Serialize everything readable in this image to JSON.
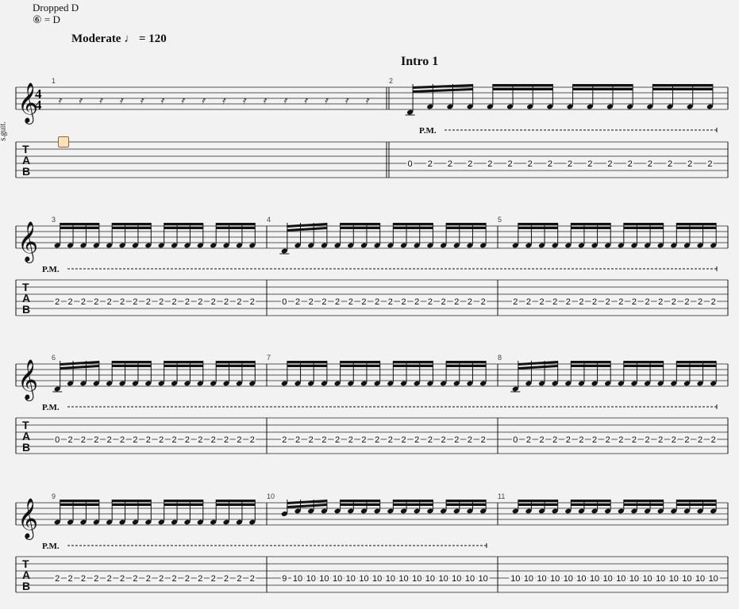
{
  "tuning": {
    "name": "Dropped D",
    "string": "⑥ = D"
  },
  "tempo": {
    "label": "Moderate",
    "note": "♩",
    "value": "= 120"
  },
  "section": "Intro 1",
  "instrument": "s.guit.",
  "time_signature": {
    "top": "4",
    "bottom": "4"
  },
  "tab_letters": [
    "T",
    "A",
    "B"
  ],
  "pm_label": "P.M.",
  "colors": {
    "line": "#555555",
    "ink": "#111111",
    "cursor": "#fbe3b4"
  },
  "systems": [
    {
      "measures": [
        {
          "number": "1",
          "rest": true,
          "frets": []
        },
        {
          "number": "2",
          "rest": false,
          "frets": [
            "0",
            "2",
            "2",
            "2",
            "2",
            "2",
            "2",
            "2",
            "2",
            "2",
            "2",
            "2",
            "2",
            "2",
            "2",
            "2"
          ],
          "pm": true
        }
      ]
    },
    {
      "measures": [
        {
          "number": "3",
          "rest": false,
          "frets": [
            "2",
            "2",
            "2",
            "2",
            "2",
            "2",
            "2",
            "2",
            "2",
            "2",
            "2",
            "2",
            "2",
            "2",
            "2",
            "2"
          ],
          "pm": true
        },
        {
          "number": "4",
          "rest": false,
          "frets": [
            "0",
            "2",
            "2",
            "2",
            "2",
            "2",
            "2",
            "2",
            "2",
            "2",
            "2",
            "2",
            "2",
            "2",
            "2",
            "2"
          ],
          "pm": true
        },
        {
          "number": "5",
          "rest": false,
          "frets": [
            "2",
            "2",
            "2",
            "2",
            "2",
            "2",
            "2",
            "2",
            "2",
            "2",
            "2",
            "2",
            "2",
            "2",
            "2",
            "2"
          ],
          "pm": true
        }
      ]
    },
    {
      "measures": [
        {
          "number": "6",
          "rest": false,
          "frets": [
            "0",
            "2",
            "2",
            "2",
            "2",
            "2",
            "2",
            "2",
            "2",
            "2",
            "2",
            "2",
            "2",
            "2",
            "2",
            "2"
          ],
          "pm": true
        },
        {
          "number": "7",
          "rest": false,
          "frets": [
            "2",
            "2",
            "2",
            "2",
            "2",
            "2",
            "2",
            "2",
            "2",
            "2",
            "2",
            "2",
            "2",
            "2",
            "2",
            "2"
          ],
          "pm": true
        },
        {
          "number": "8",
          "rest": false,
          "frets": [
            "0",
            "2",
            "2",
            "2",
            "2",
            "2",
            "2",
            "2",
            "2",
            "2",
            "2",
            "2",
            "2",
            "2",
            "2",
            "2"
          ],
          "pm": true
        }
      ]
    },
    {
      "measures": [
        {
          "number": "9",
          "rest": false,
          "frets": [
            "2",
            "2",
            "2",
            "2",
            "2",
            "2",
            "2",
            "2",
            "2",
            "2",
            "2",
            "2",
            "2",
            "2",
            "2",
            "2"
          ],
          "pm": true
        },
        {
          "number": "10",
          "rest": false,
          "frets": [
            "9",
            "10",
            "10",
            "10",
            "10",
            "10",
            "10",
            "10",
            "10",
            "10",
            "10",
            "10",
            "10",
            "10",
            "10",
            "10"
          ],
          "pm": true,
          "high": true
        },
        {
          "number": "11",
          "rest": false,
          "frets": [
            "10",
            "10",
            "10",
            "10",
            "10",
            "10",
            "10",
            "10",
            "10",
            "10",
            "10",
            "10",
            "10",
            "10",
            "10",
            "10"
          ],
          "pm": false,
          "high": true
        }
      ]
    }
  ]
}
